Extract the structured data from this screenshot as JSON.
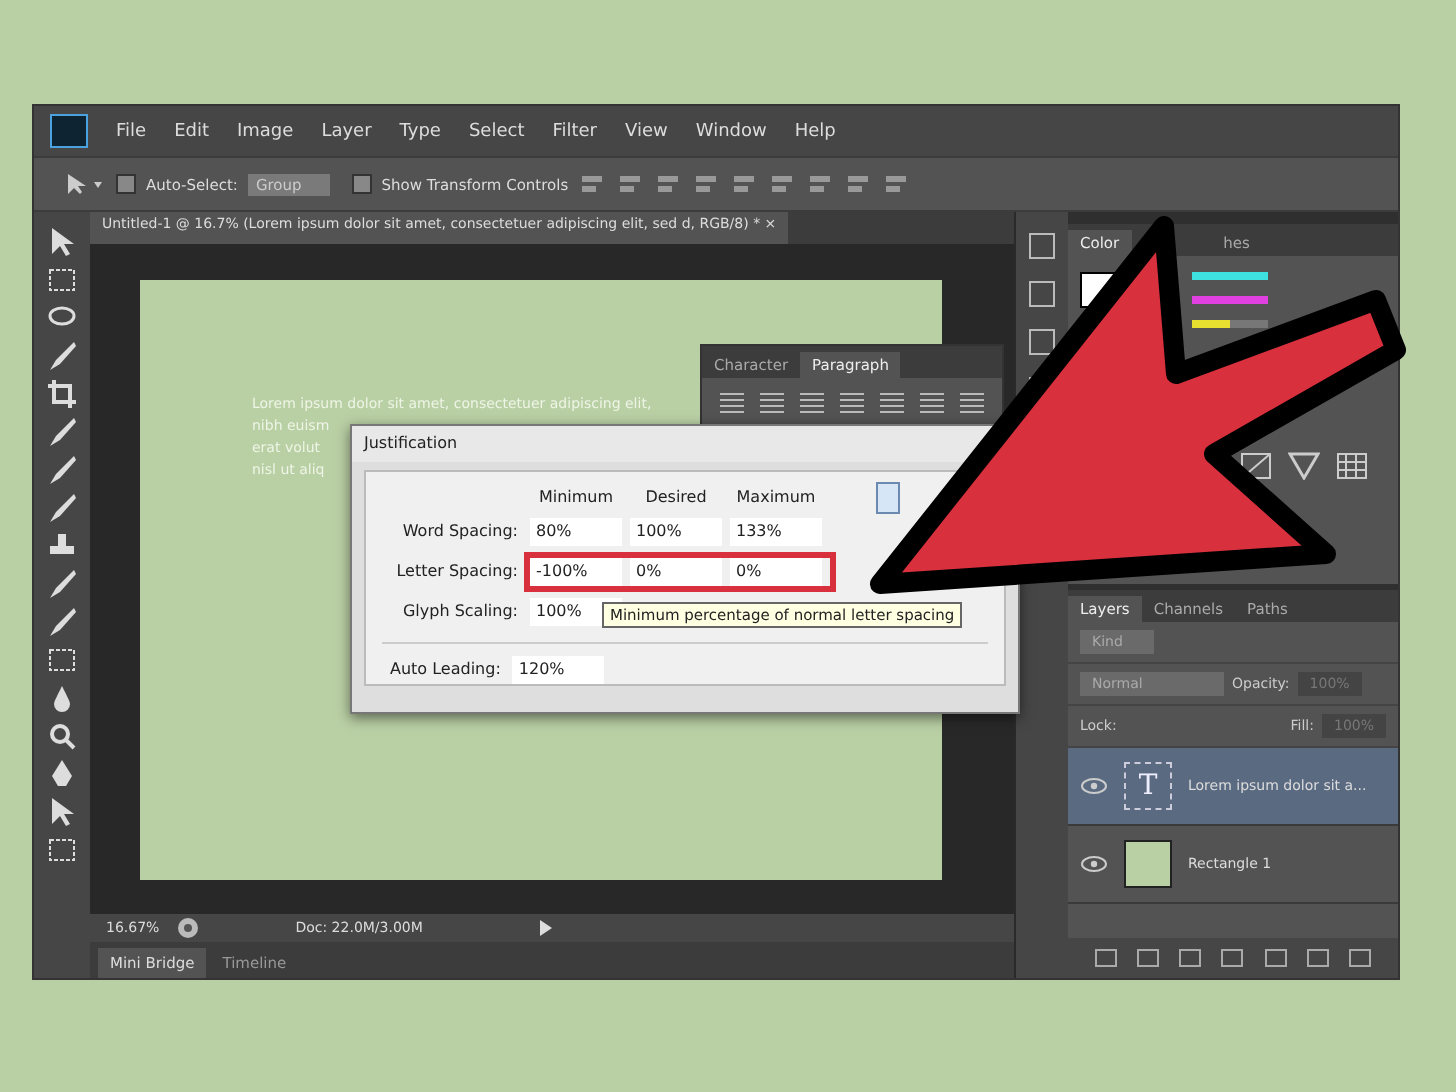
{
  "menu": [
    "File",
    "Edit",
    "Image",
    "Layer",
    "Type",
    "Select",
    "Filter",
    "View",
    "Window",
    "Help"
  ],
  "options_bar": {
    "auto_select_label": "Auto-Select:",
    "auto_select_checked": false,
    "auto_select_value": "Group",
    "show_transform_label": "Show Transform Controls",
    "show_transform_checked": false
  },
  "document": {
    "tab_title": "Untitled-1 @ 16.7% (Lorem ipsum dolor sit amet, consectetuer adipiscing elit, sed d, RGB/8) *",
    "close": "×",
    "canvas_text": [
      "Lorem ipsum dolor sit amet, consectetuer adipiscing elit,",
      "nibh euism",
      "erat volut",
      "nisl ut aliq"
    ],
    "zoom": "16.67%",
    "doc_info": "Doc: 22.0M/3.00M"
  },
  "bottom_tabs": [
    {
      "label": "Mini Bridge",
      "selected": true
    },
    {
      "label": "Timeline",
      "selected": false
    }
  ],
  "paragraph_panel": {
    "tabs": [
      {
        "label": "Character",
        "selected": false
      },
      {
        "label": "Paragraph",
        "selected": true
      }
    ]
  },
  "justification_dialog": {
    "title": "Justification",
    "columns": [
      "Minimum",
      "Desired",
      "Maximum"
    ],
    "rows": [
      {
        "label": "Word Spacing:",
        "values": [
          "80%",
          "100%",
          "133%"
        ],
        "highlighted": false
      },
      {
        "label": "Letter Spacing:",
        "values": [
          "-100%",
          "0%",
          "0%"
        ],
        "highlighted": true
      },
      {
        "label": "Glyph Scaling:",
        "values": [
          "100%"
        ],
        "highlighted": false
      }
    ],
    "auto_leading": {
      "label": "Auto Leading:",
      "value": "120%"
    },
    "tooltip": "Minimum percentage of normal letter spacing"
  },
  "color_panel": {
    "tabs": [
      {
        "label": "Color",
        "selected": true
      },
      {
        "label": "hes",
        "selected": false
      }
    ],
    "sliders": [
      {
        "level": 1,
        "color": "#3fe0e0"
      },
      {
        "level": 1,
        "color": "#e040e0"
      },
      {
        "level": 0.5,
        "color": "#e8e030"
      }
    ]
  },
  "layers_panel": {
    "tabs": [
      {
        "label": "Layers",
        "selected": true
      },
      {
        "label": "Channels",
        "selected": false
      },
      {
        "label": "Paths",
        "selected": false
      }
    ],
    "filter": "Kind",
    "blend_mode": "Normal",
    "opacity_label": "Opacity:",
    "opacity": "100%",
    "lock_label": "Lock:",
    "fill_label": "Fill:",
    "fill": "100%",
    "layers": [
      {
        "name": "Lorem ipsum dolor sit a...",
        "kind": "text",
        "glyph": "T",
        "selected": true,
        "visible": true
      },
      {
        "name": "Rectangle 1",
        "kind": "shape",
        "selected": false,
        "visible": true
      }
    ]
  }
}
